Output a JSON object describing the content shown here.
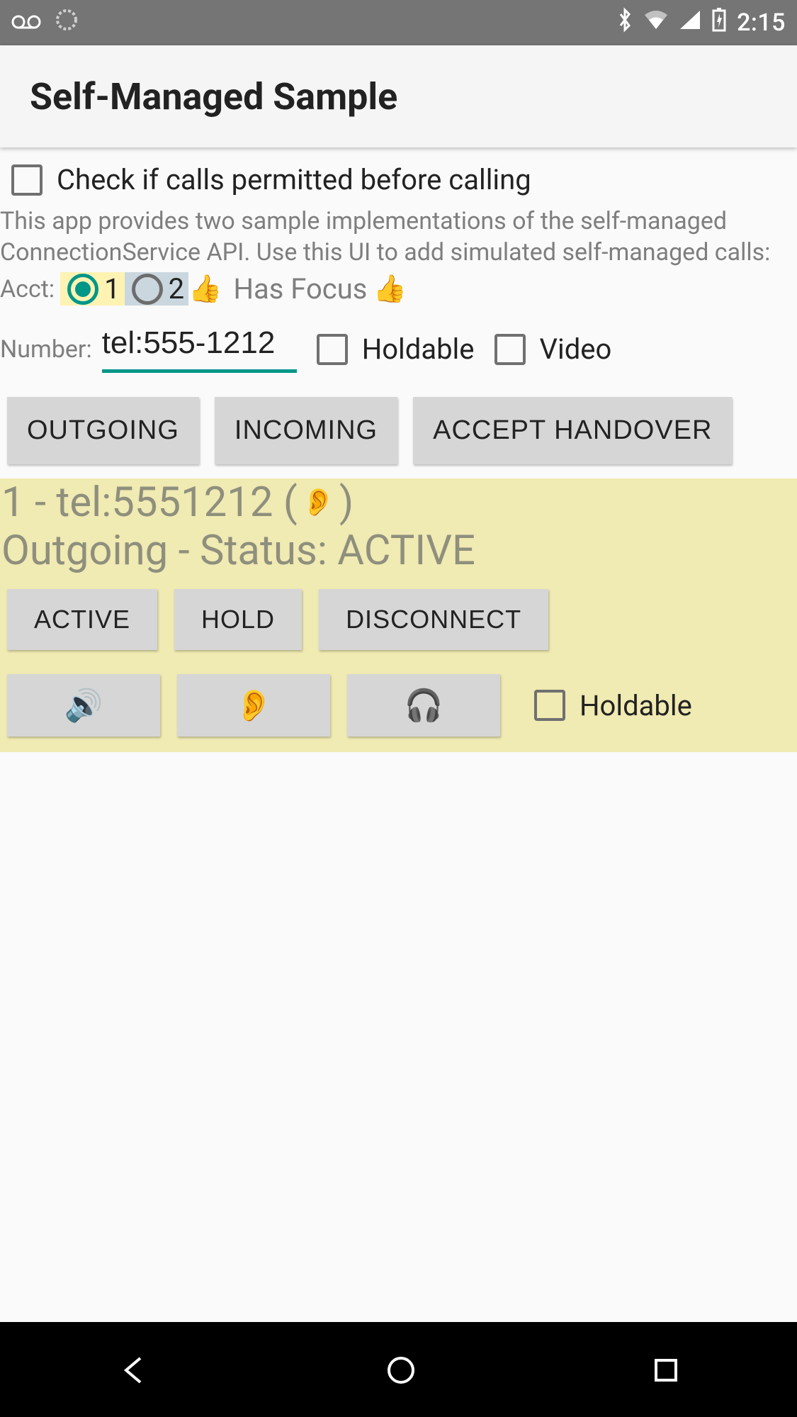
{
  "status_bar": {
    "time": "2:15"
  },
  "app_bar": {
    "title": "Self-Managed Sample"
  },
  "check_calls": {
    "label": "Check if calls permitted before calling",
    "checked": false
  },
  "description": "This app provides two sample implementations of the self-managed ConnectionService API.  Use this UI to add simulated self-managed calls:",
  "acct": {
    "label": "Acct:",
    "opt1": "1",
    "opt2": "2",
    "selected": 1,
    "focus_text": "Has Focus",
    "thumb": "👍"
  },
  "number": {
    "label": "Number:",
    "value": "tel:555-1212",
    "holdable_label": "Holdable",
    "holdable_checked": false,
    "video_label": "Video",
    "video_checked": false
  },
  "actions": {
    "outgoing": "OUTGOING",
    "incoming": "INCOMING",
    "accept_handover": "ACCEPT HANDOVER"
  },
  "call": {
    "line1_prefix": "1 - tel:5551212 (",
    "line1_ear": "👂",
    "line1_suffix": " )",
    "line2": "Outgoing - Status: ACTIVE",
    "btn_active": "ACTIVE",
    "btn_hold": "HOLD",
    "btn_disconnect": "DISCONNECT",
    "btn_speaker": "🔊",
    "btn_ear": "👂",
    "btn_headphone": "🎧",
    "holdable_label": "Holdable",
    "holdable_checked": false
  }
}
